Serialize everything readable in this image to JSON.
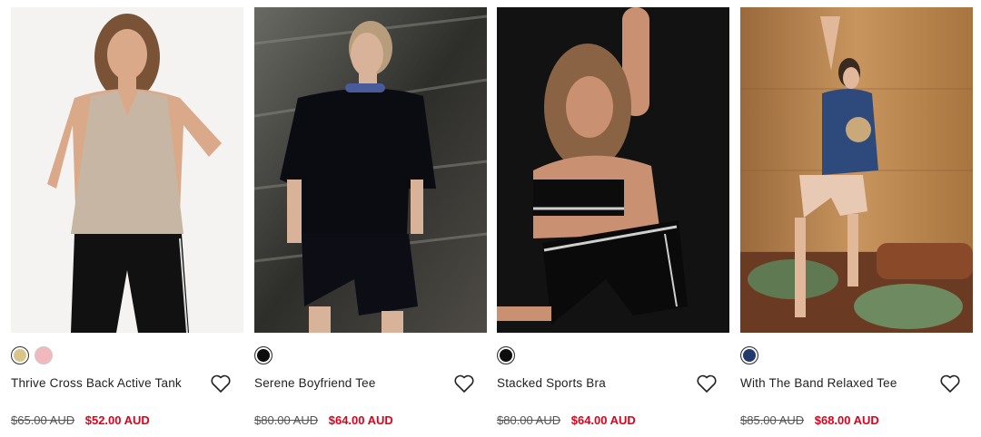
{
  "products": [
    {
      "name": "Thrive Cross Back Active Tank",
      "was_price": "$65.00 AUD",
      "sale_price": "$52.00 AUD",
      "swatches": [
        {
          "color": "#d9c48a",
          "selected": true
        },
        {
          "color": "#f2b8bd",
          "selected": false
        }
      ],
      "photo": {
        "bg": "#f4f3f1",
        "top": "#c6b6a3",
        "bottom": "#111111",
        "skin": "#d9a98a",
        "hair": "#7a5236"
      }
    },
    {
      "name": "Serene Boyfriend Tee",
      "was_price": "$80.00 AUD",
      "sale_price": "$64.00 AUD",
      "swatches": [
        {
          "color": "#0d0d0d",
          "selected": true
        }
      ],
      "photo": {
        "bg": "#3a3a36",
        "top": "#0b0c12",
        "bottom": "#0d0e15",
        "skin": "#d8b39a",
        "hair": "#b89d7c"
      }
    },
    {
      "name": "Stacked Sports Bra",
      "was_price": "$80.00 AUD",
      "sale_price": "$64.00 AUD",
      "swatches": [
        {
          "color": "#0d0d0d",
          "selected": true
        }
      ],
      "photo": {
        "bg": "#121212",
        "top": "#0c0c0c",
        "bottom": "#0a0a0a",
        "skin": "#c99072",
        "hair": "#8a6344"
      }
    },
    {
      "name": "With The Band Relaxed Tee",
      "was_price": "$85.00 AUD",
      "sale_price": "$68.00 AUD",
      "swatches": [
        {
          "color": "#223a6b",
          "selected": true
        }
      ],
      "photo": {
        "bg": "#b8834f",
        "top": "#2e4a7c",
        "bottom": "#e8c9b4",
        "skin": "#e2b89a",
        "hair": "#3b2a20"
      }
    }
  ],
  "icons": {
    "wishlist": "heart-outline-icon"
  },
  "colors": {
    "sale": "#e0001b",
    "was": "#555555",
    "text": "#222222"
  }
}
